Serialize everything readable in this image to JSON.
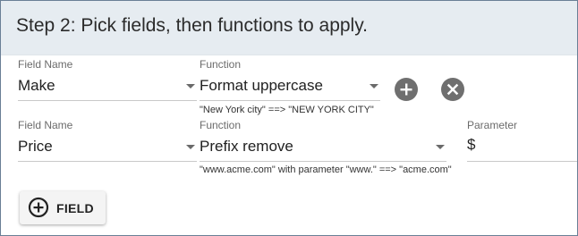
{
  "header": {
    "title": "Step 2: Pick fields, then functions to apply."
  },
  "rows": [
    {
      "field_label": "Field Name",
      "field_value": "Make",
      "function_label": "Function",
      "function_value": "Format uppercase",
      "example": "\"New York city\" ==> \"NEW YORK CITY\"",
      "add_icon": "plus-circle-icon",
      "remove_icon": "x-circle-icon"
    },
    {
      "field_label": "Field Name",
      "field_value": "Price",
      "function_label": "Function",
      "function_value": "Prefix remove",
      "parameter_label": "Parameter",
      "parameter_value": "$",
      "example": "\"www.acme.com\" with parameter \"www.\" ==> \"acme.com\""
    }
  ],
  "add_field_button": {
    "label": "FIELD",
    "icon": "plus-circle-outline-icon"
  },
  "colors": {
    "header_bg": "#e6ecf1",
    "border": "#6a7f96",
    "icon_button": "#6f6f6f"
  }
}
